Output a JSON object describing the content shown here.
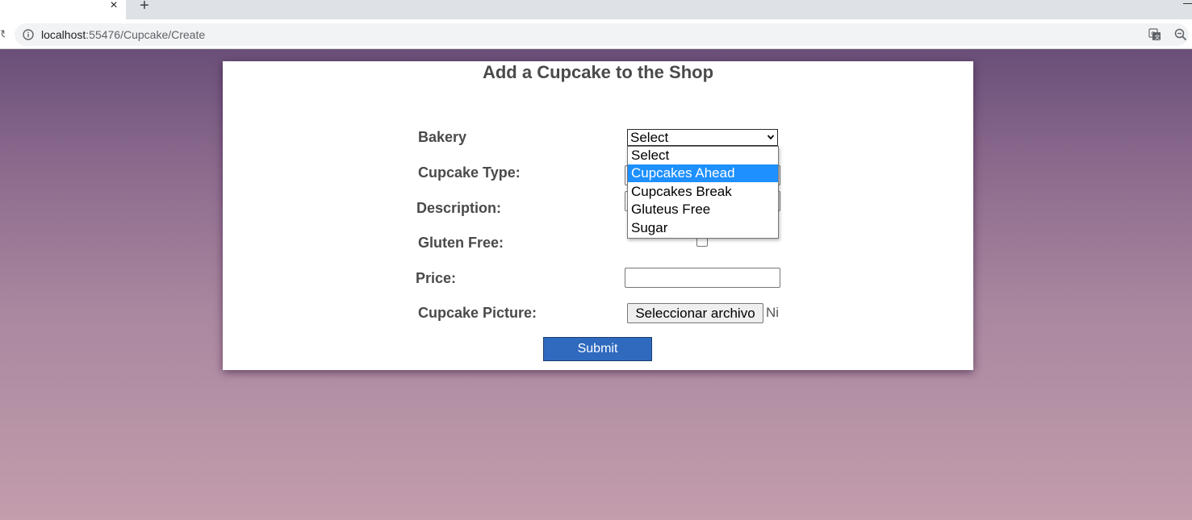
{
  "browser": {
    "url_host": "localhost",
    "url_path": ":55476/Cupcake/Create",
    "tab_close_glyph": "×",
    "new_tab_glyph": "+",
    "icons": [
      "info-icon",
      "translate-icon",
      "zoom-icon"
    ]
  },
  "page": {
    "title": "Add a Cupcake to the Shop",
    "background_top": "#6a4f78",
    "background_bottom": "#c39dac"
  },
  "form": {
    "bakery_label": "Bakery",
    "cupcake_type_label": "Cupcake Type:",
    "description_label": "Description:",
    "gluten_free_label": "Gluten Free:",
    "price_label": "Price:",
    "picture_label": "Cupcake Picture:",
    "bakery_selected": "Select",
    "file_button_label": "Seleccionar archivo",
    "file_status": "Ni",
    "submit_label": "Submit",
    "submit_color": "#2f6abf",
    "gluten_free_checked": false
  },
  "dropdown": {
    "options": [
      "Select",
      "Cupcakes Ahead",
      "Cupcakes Break",
      "Gluteus Free",
      "Sugar"
    ],
    "highlighted": "Cupcakes Ahead",
    "highlight_color": "#1e90ff"
  }
}
